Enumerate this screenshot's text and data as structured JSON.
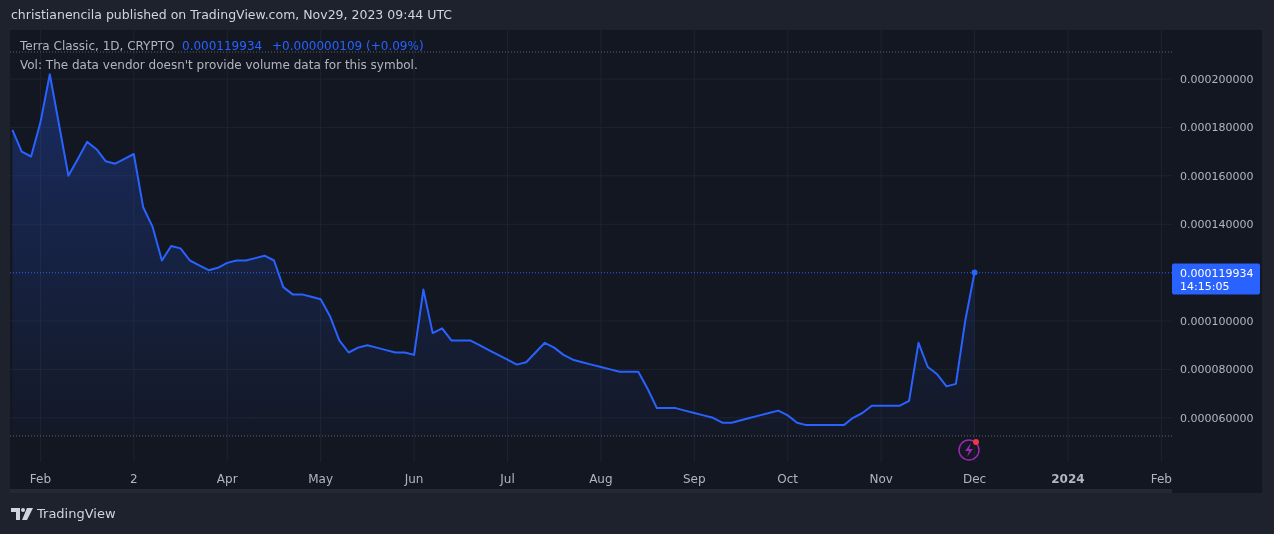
{
  "header": {
    "text": "christianencila published on TradingView.com, Nov29, 2023 09:44 UTC"
  },
  "legend": {
    "symbol": "Terra Classic, 1D, CRYPTO",
    "price": "0.000119934",
    "change": "+0.000000109 (+0.09%)",
    "vol_note": "Vol: The data vendor doesn't provide volume data for this symbol."
  },
  "price_label": {
    "price": "0.000119934",
    "countdown": "14:15:05"
  },
  "chart": {
    "chart_data": {
      "type": "area",
      "categories": [
        null,
        null,
        null,
        "Feb",
        null,
        null,
        null,
        null,
        null,
        null,
        null,
        null,
        null,
        "2",
        null,
        null,
        null,
        null,
        null,
        null,
        null,
        null,
        null,
        "Apr",
        null,
        null,
        null,
        null,
        null,
        null,
        null,
        null,
        null,
        "May",
        null,
        null,
        null,
        null,
        null,
        null,
        null,
        null,
        null,
        "Jun",
        null,
        null,
        null,
        null,
        null,
        null,
        null,
        null,
        null,
        "Jul",
        null,
        null,
        null,
        null,
        null,
        null,
        null,
        null,
        null,
        "Aug",
        null,
        null,
        null,
        null,
        null,
        null,
        null,
        null,
        null,
        "Sep",
        null,
        null,
        null,
        null,
        null,
        null,
        null,
        null,
        null,
        "Oct",
        null,
        null,
        null,
        null,
        null,
        null,
        null,
        null,
        null,
        "Nov",
        null,
        null,
        null,
        null,
        null,
        null,
        null,
        null,
        null,
        "Dec",
        null,
        null,
        null,
        null,
        null,
        null,
        null,
        null,
        null,
        "2024",
        null,
        null,
        null,
        null,
        null,
        null,
        null,
        null,
        null,
        "Feb"
      ],
      "series": [
        {
          "color": "#2962ff",
          "values": [
            0.000179,
            0.00017,
            0.000168,
            0.000182,
            0.000202,
            0.000181,
            0.00016,
            0.000167,
            0.000174,
            0.000171,
            0.000166,
            0.000165,
            0.000167,
            0.000169,
            0.000147,
            0.000139,
            0.000125,
            0.000131,
            0.00013,
            0.000125,
            0.000123,
            0.000121,
            0.000122,
            0.000124,
            0.000125,
            0.000125,
            0.000126,
            0.000127,
            0.000125,
            0.000114,
            0.000111,
            0.000111,
            0.00011,
            0.000109,
            0.000102,
            9.2e-05,
            8.7e-05,
            8.9e-05,
            9e-05,
            8.9e-05,
            8.8e-05,
            8.7e-05,
            8.7e-05,
            8.6e-05,
            0.000113,
            9.5e-05,
            9.7e-05,
            9.2e-05,
            9.2e-05,
            9.2e-05,
            9e-05,
            8.8e-05,
            8.6e-05,
            8.4e-05,
            8.2e-05,
            8.3e-05,
            8.7e-05,
            9.1e-05,
            8.9e-05,
            8.6e-05,
            8.4e-05,
            8.3e-05,
            8.2e-05,
            8.1e-05,
            8e-05,
            7.9e-05,
            7.9e-05,
            7.9e-05,
            7.2e-05,
            6.4e-05,
            6.4e-05,
            6.4e-05,
            6.3e-05,
            6.2e-05,
            6.1e-05,
            6e-05,
            5.8e-05,
            5.8e-05,
            5.9e-05,
            6e-05,
            6.1e-05,
            6.2e-05,
            6.3e-05,
            6.1e-05,
            5.8e-05,
            5.7e-05,
            5.7e-05,
            5.7e-05,
            5.7e-05,
            5.7e-05,
            6e-05,
            6.2e-05,
            6.5e-05,
            6.5e-05,
            6.5e-05,
            6.5e-05,
            6.7e-05,
            9.1e-05,
            8.1e-05,
            7.8e-05,
            7.3e-05,
            7.4e-05,
            0.0001,
            0.00012,
            null,
            null,
            null,
            null,
            null,
            null,
            null,
            null,
            null,
            null,
            null,
            null,
            null,
            null,
            null,
            null,
            null,
            null,
            null,
            null
          ]
        }
      ],
      "ylim": [
        4.17e-05,
        0.0002103
      ],
      "grid": true,
      "ref_lines": [
        {
          "axis": "y",
          "value": 0.000119934,
          "color": "#2962ff"
        },
        {
          "axis": "y",
          "value": 5.25e-05,
          "color": "#5d606b"
        }
      ],
      "yticks": [
        {
          "value": 6e-05,
          "label": "0.000060000"
        },
        {
          "value": 8e-05,
          "label": "0.000080000"
        },
        {
          "value": 0.0001,
          "label": "0.000100000"
        },
        {
          "value": 0.00014,
          "label": "0.000140000"
        },
        {
          "value": 0.00016,
          "label": "0.000160000"
        },
        {
          "value": 0.00018,
          "label": "0.000180000"
        },
        {
          "value": 0.0002,
          "label": "0.000200000"
        }
      ]
    }
  },
  "footer": {
    "brand": "TradingView"
  }
}
